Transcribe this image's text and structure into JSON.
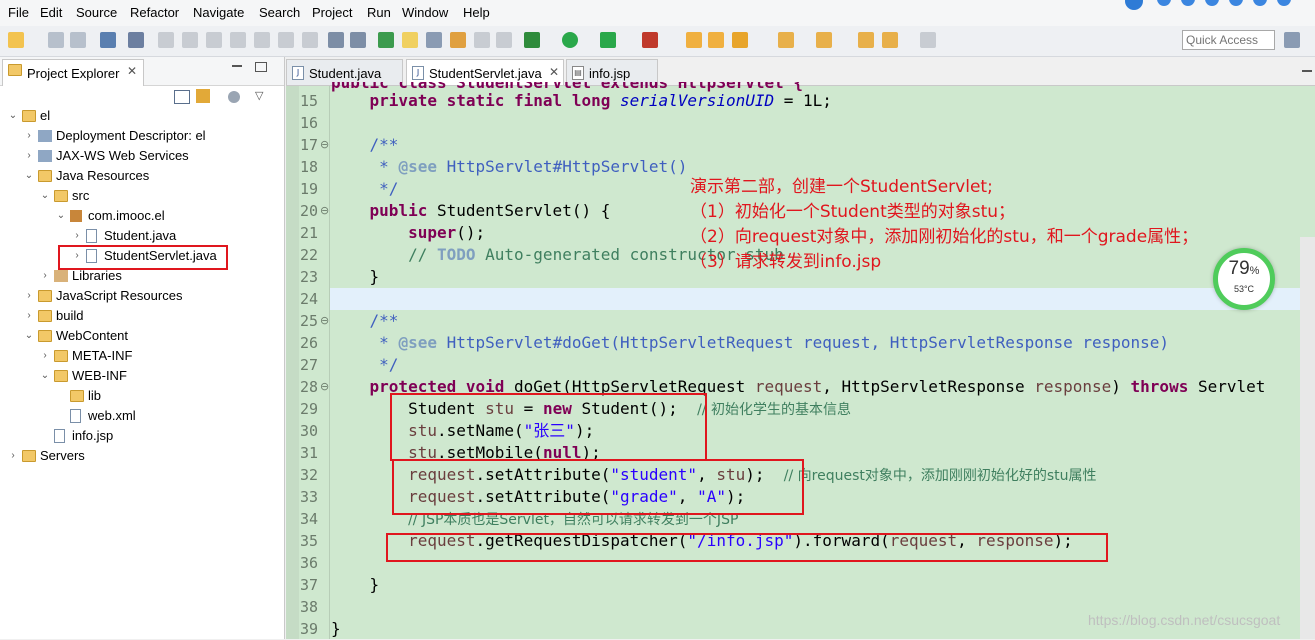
{
  "menu": [
    "File",
    "Edit",
    "Source",
    "Refactor",
    "Navigate",
    "Search",
    "Project",
    "Run",
    "Window",
    "Help"
  ],
  "quick_access": {
    "placeholder": "Quick Access"
  },
  "project_explorer": {
    "title": "Project Explorer",
    "tree": [
      {
        "label": "el",
        "depth": 0,
        "expanded": true,
        "icon": "project-icon"
      },
      {
        "label": "Deployment Descriptor: el",
        "depth": 1,
        "expanded": false,
        "icon": "descriptor-icon"
      },
      {
        "label": "JAX-WS Web Services",
        "depth": 1,
        "expanded": false,
        "icon": "webservice-icon"
      },
      {
        "label": "Java Resources",
        "depth": 1,
        "expanded": true,
        "icon": "java-resources-icon"
      },
      {
        "label": "src",
        "depth": 2,
        "expanded": true,
        "icon": "source-folder-icon"
      },
      {
        "label": "com.imooc.el",
        "depth": 3,
        "expanded": true,
        "icon": "package-icon"
      },
      {
        "label": "Student.java",
        "depth": 4,
        "expanded": false,
        "icon": "java-file-icon"
      },
      {
        "label": "StudentServlet.java",
        "depth": 4,
        "expanded": false,
        "icon": "java-file-icon"
      },
      {
        "label": "Libraries",
        "depth": 2,
        "expanded": false,
        "icon": "libraries-icon"
      },
      {
        "label": "JavaScript Resources",
        "depth": 1,
        "expanded": false,
        "icon": "js-resources-icon"
      },
      {
        "label": "build",
        "depth": 1,
        "expanded": false,
        "icon": "folder-icon"
      },
      {
        "label": "WebContent",
        "depth": 1,
        "expanded": true,
        "icon": "folder-icon"
      },
      {
        "label": "META-INF",
        "depth": 2,
        "expanded": false,
        "icon": "folder-icon"
      },
      {
        "label": "WEB-INF",
        "depth": 2,
        "expanded": true,
        "icon": "folder-icon"
      },
      {
        "label": "lib",
        "depth": 3,
        "expanded": false,
        "icon": "folder-icon"
      },
      {
        "label": "web.xml",
        "depth": 3,
        "expanded": false,
        "icon": "xml-file-icon"
      },
      {
        "label": "info.jsp",
        "depth": 2,
        "expanded": false,
        "icon": "jsp-file-icon"
      },
      {
        "label": "Servers",
        "depth": 0,
        "expanded": false,
        "icon": "folder-icon"
      }
    ]
  },
  "editor": {
    "tabs": [
      {
        "label": "Student.java",
        "active": false
      },
      {
        "label": "StudentServlet.java",
        "active": true
      },
      {
        "label": "info.jsp",
        "active": false
      }
    ],
    "lines": [
      {
        "n": "15",
        "fold": ""
      },
      {
        "n": "16",
        "fold": ""
      },
      {
        "n": "17",
        "fold": "⊖"
      },
      {
        "n": "18",
        "fold": ""
      },
      {
        "n": "19",
        "fold": ""
      },
      {
        "n": "20",
        "fold": "⊖"
      },
      {
        "n": "21",
        "fold": ""
      },
      {
        "n": "22",
        "fold": ""
      },
      {
        "n": "23",
        "fold": ""
      },
      {
        "n": "24",
        "fold": ""
      },
      {
        "n": "25",
        "fold": "⊖"
      },
      {
        "n": "26",
        "fold": ""
      },
      {
        "n": "27",
        "fold": ""
      },
      {
        "n": "28",
        "fold": "⊖"
      },
      {
        "n": "29",
        "fold": ""
      },
      {
        "n": "30",
        "fold": ""
      },
      {
        "n": "31",
        "fold": ""
      },
      {
        "n": "32",
        "fold": ""
      },
      {
        "n": "33",
        "fold": ""
      },
      {
        "n": "34",
        "fold": ""
      },
      {
        "n": "35",
        "fold": ""
      },
      {
        "n": "36",
        "fold": ""
      },
      {
        "n": "37",
        "fold": ""
      },
      {
        "n": "38",
        "fold": ""
      },
      {
        "n": "39",
        "fold": ""
      }
    ],
    "tokens": {
      "l15_kw": "private static final long",
      "l15_fld": "serialVersionUID",
      "l15_rest": " = 1L;",
      "l17": "/**",
      "l18_pre": " * ",
      "l18_tag": "@see",
      "l18_rest": " HttpServlet#HttpServlet()",
      "l19": " */",
      "l20_kw": "public",
      "l20_rest": " StudentServlet() {",
      "l21_kw": "super",
      "l21_rest": "();",
      "l22_pre": "// ",
      "l22_todo": "TODO",
      "l22_rest": " Auto-generated constructor stub",
      "l23": "}",
      "l25": "/**",
      "l26_pre": " * ",
      "l26_tag": "@see",
      "l26_rest": " HttpServlet#doGet(HttpServletRequest request, HttpServletResponse response)",
      "l27": " */",
      "l28_kw1": "protected void",
      "l28_a": " doGet(HttpServletRequest ",
      "l28_p1": "request",
      "l28_b": ", HttpServletResponse ",
      "l28_p2": "response",
      "l28_c": ") ",
      "l28_kw2": "throws",
      "l28_d": " Servlet",
      "l29_a": "Student ",
      "l29_v": "stu",
      "l29_b": " = ",
      "l29_kw": "new",
      "l29_c": " Student();  ",
      "l29_cm": "// 初始化学生的基本信息",
      "l30_v": "stu",
      "l30_a": ".setName(",
      "l30_s": "\"张三\"",
      "l30_b": ");",
      "l31_v": "stu",
      "l31_a": ".setMobile(",
      "l31_kw": "null",
      "l31_b": ");",
      "l32_p": "request",
      "l32_a": ".setAttribute(",
      "l32_s": "\"student\"",
      "l32_b": ", ",
      "l32_v": "stu",
      "l32_c": ");  ",
      "l32_cm": "// 向request对象中，添加刚刚初始化好的stu属性",
      "l33_p": "request",
      "l33_a": ".setAttribute(",
      "l33_s1": "\"grade\"",
      "l33_b": ", ",
      "l33_s2": "\"A\"",
      "l33_c": ");",
      "l34_cm": "// JSP本质也是Servlet，自然可以请求转发到一个JSP",
      "l35_p1": "request",
      "l35_a": ".getRequestDispatcher(",
      "l35_s": "\"/info.jsp\"",
      "l35_b": ").forward(",
      "l35_p2": "request",
      "l35_c": ", ",
      "l35_p3": "response",
      "l35_d": ");",
      "l37": "}",
      "l39": "}"
    }
  },
  "annotation": {
    "title": "演示第二部，创建一个StudentServlet;",
    "step1": "（1）初始化一个Student类型的对象stu；",
    "step2": "（2）向request对象中，添加刚初始化的stu，和一个grade属性；",
    "step3": "（3）请求转发到info.jsp"
  },
  "gauge": {
    "percent": "79",
    "unit": "%",
    "temp": "53°C"
  },
  "watermark": "https://blog.csdn.net/csucsgoat",
  "colors": {
    "editor_bg": "#cfe8cf",
    "keyword": "#7f0055",
    "string": "#2a00ff",
    "comment": "#3f7f5f",
    "javadoc": "#3f5fbf",
    "annotation_red": "#e0161e"
  }
}
